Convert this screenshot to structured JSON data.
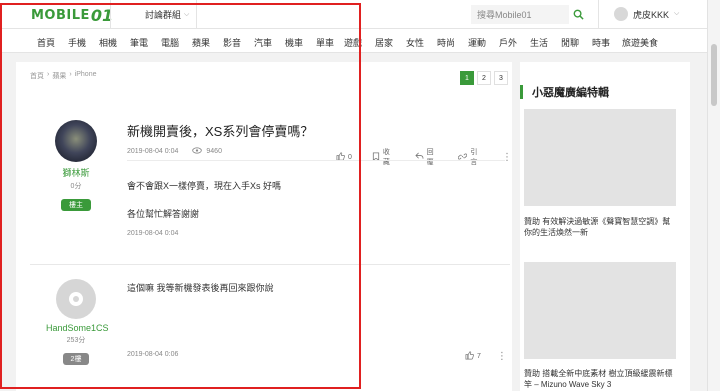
{
  "header": {
    "logo_text": "MOBILE",
    "logo_num": "01",
    "forum_menu": "討論群組",
    "search_placeholder": "搜尋Mobile01",
    "username": "虎皮KKK"
  },
  "nav": [
    "首頁",
    "手機",
    "相機",
    "筆電",
    "電腦",
    "蘋果",
    "影音",
    "汽車",
    "機車",
    "單車",
    "遊戲",
    "居家",
    "女性",
    "時尚",
    "運動",
    "戶外",
    "生活",
    "閒聊",
    "時事",
    "旅遊美食"
  ],
  "breadcrumb": [
    "首頁",
    "蘋果",
    "iPhone"
  ],
  "pagination": [
    "1",
    "2",
    "3"
  ],
  "post1": {
    "author": "獅林斯",
    "score": "0分",
    "badge": "樓主",
    "title": "新機開賣後，XS系列會停賣嗎？",
    "date": "2019-08-04 0:04",
    "views": "9460",
    "likes": "0",
    "fav": "收藏",
    "reply": "回覆",
    "quote": "引言",
    "line1": "會不會跟X一樣停賣，現在入手Xs 好嗎",
    "line2": "各位幫忙解答謝謝",
    "date_bottom": "2019-08-04 0:04"
  },
  "post2": {
    "author": "HandSome1CS",
    "score": "253分",
    "badge": "2樓",
    "text": "這個嘛 我等新機發表後再回來跟你說",
    "date": "2019-08-04 0:06",
    "likes": "7"
  },
  "sidebar": {
    "title": "小惡魔廣編特輯",
    "ad1": "贊助 有效解決過敏源《聲寶智慧空調》幫你的生活煥然一新",
    "ad2": "贊助 搭載全新中底素材 樹立頂級緩震新標竿 – Mizuno Wave Sky 3"
  },
  "colors": {
    "accent": "#3a9a3a",
    "annotation": "#e02020"
  }
}
